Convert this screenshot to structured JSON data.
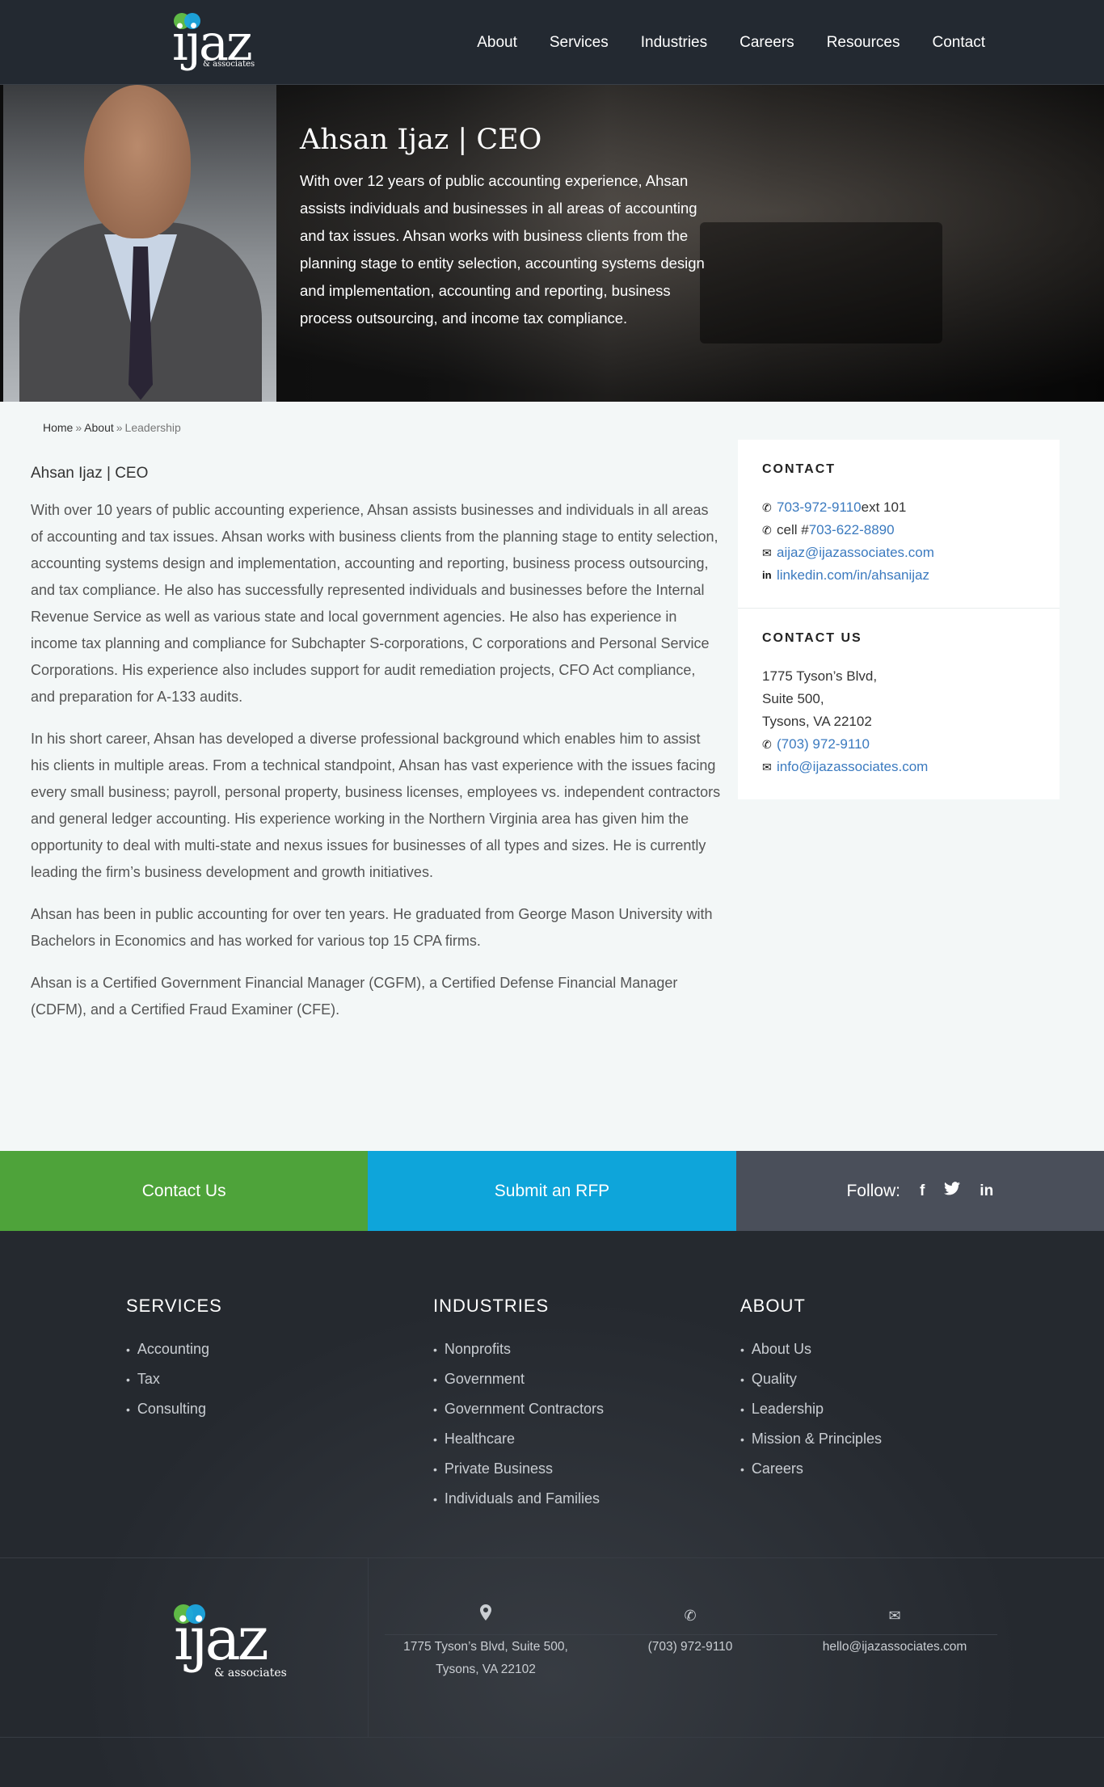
{
  "header": {
    "logo_word": "ijaz",
    "logo_sub": "& associates",
    "nav": [
      "About",
      "Services",
      "Industries",
      "Careers",
      "Resources",
      "Contact"
    ]
  },
  "hero": {
    "title": "Ahsan Ijaz | CEO",
    "body": "With over 12 years of public accounting experience, Ahsan assists individuals and businesses in all areas of accounting and tax issues. Ahsan works with business clients from the planning stage to entity selection, accounting systems design and implementation, accounting and reporting, business process outsourcing, and income tax compliance."
  },
  "breadcrumb": {
    "home": "Home",
    "sep": "»",
    "about": "About",
    "current": "Leadership"
  },
  "main": {
    "heading": "Ahsan Ijaz | CEO",
    "paragraphs": [
      "With over 10 years of public accounting experience, Ahsan assists businesses and individuals in all areas of accounting and tax issues. Ahsan works with business clients from the planning stage to entity selection, accounting systems design and implementation, accounting and reporting, business process outsourcing, and tax compliance. He also has successfully represented individuals and businesses before the Internal Revenue Service as well as various state and local government agencies. He also has experience in income tax planning and compliance for Subchapter S-corporations, C corporations and Personal Service Corporations. His experience also includes support for audit remediation projects, CFO Act compliance, and preparation for A-133 audits.",
      "In his short career, Ahsan has developed a diverse professional background which enables him to assist his clients in multiple areas. From a technical standpoint, Ahsan has vast experience with the issues facing every small business; payroll, personal property, business licenses, employees vs. independent contractors and general ledger accounting. His experience working in the Northern Virginia area has given him the opportunity to deal with multi-state and nexus issues for businesses of all types and sizes. He is currently leading the firm’s business development and growth initiatives.",
      "Ahsan has been in public accounting for over ten years. He graduated from George Mason University with Bachelors in Economics and has worked for various top 15 CPA firms.",
      "Ahsan is a Certified Government Financial Manager (CGFM), a Certified Defense Financial Manager (CDFM), and a Certified Fraud Examiner (CFE)."
    ]
  },
  "sidebar": {
    "contact_title": "CONTACT",
    "phone": "703-972-9110",
    "phone_ext": " ext 101",
    "cell_label": "cell # ",
    "cell": "703-622-8890",
    "email": "aijaz@ijazassociates.com",
    "linkedin": "linkedin.com/in/ahsanijaz",
    "contact_us_title": "CONTACT US",
    "address1": "1775 Tyson’s Blvd,",
    "address2": "Suite 500,",
    "address3": "Tysons, VA 22102",
    "office_phone": "(703) 972-9110",
    "office_email": "info@ijazassociates.com"
  },
  "cta": {
    "contact": "Contact Us",
    "rfp": "Submit an RFP",
    "follow": "Follow:",
    "facebook": "f",
    "twitter": "t",
    "linkedin": "in"
  },
  "footer": {
    "services_title": "SERVICES",
    "services": [
      "Accounting",
      "Tax",
      "Consulting"
    ],
    "industries_title": "INDUSTRIES",
    "industries": [
      "Nonprofits",
      "Government",
      "Government Contractors",
      "Healthcare",
      "Private Business",
      "Individuals and Families"
    ],
    "about_title": "ABOUT",
    "about": [
      "About Us",
      "Quality",
      "Leadership",
      "Mission & Principles",
      "Careers"
    ],
    "logo_word": "ijaz",
    "logo_sub": "& associates",
    "address_line1": "1775 Tyson’s Blvd, Suite 500,",
    "address_line2": "Tysons, VA 22102",
    "phone": "(703) 972-9110",
    "email": "hello@ijazassociates.com"
  },
  "icons": {
    "phone": "phone-icon",
    "email": "envelope-icon",
    "linkedin": "linkedin-icon",
    "map_pin": "map-pin-icon"
  },
  "colors": {
    "header_bg": "#232931",
    "green": "#4ea33a",
    "blue": "#0ea5da",
    "gray": "#4a4f5a",
    "link": "#3b7abf"
  }
}
